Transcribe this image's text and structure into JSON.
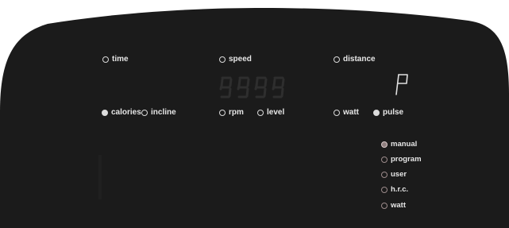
{
  "top_row": [
    {
      "id": "time",
      "label": "time",
      "filled": false
    },
    {
      "id": "speed",
      "label": "speed",
      "filled": false
    },
    {
      "id": "distance",
      "label": "distance",
      "filled": false
    }
  ],
  "middle_row": [
    {
      "id": "calories",
      "label": "calories",
      "filled": true
    },
    {
      "id": "incline",
      "label": "incline",
      "filled": false
    },
    {
      "id": "rpm",
      "label": "rpm",
      "filled": false
    },
    {
      "id": "level",
      "label": "level",
      "filled": false
    },
    {
      "id": "watt",
      "label": "watt",
      "filled": false
    },
    {
      "id": "pulse",
      "label": "pulse",
      "filled": true
    }
  ],
  "display": {
    "program_char": "P"
  },
  "modes": [
    {
      "id": "manual",
      "label": "manual",
      "active": true
    },
    {
      "id": "program",
      "label": "program",
      "active": false
    },
    {
      "id": "user",
      "label": "user",
      "active": false
    },
    {
      "id": "hrc",
      "label": "h.r.c.",
      "active": false
    },
    {
      "id": "watt",
      "label": "watt",
      "active": false
    }
  ],
  "colors": {
    "panel": "#1b1b1b",
    "text": "#e6e6e6",
    "mode_ring": "#9b8a8a"
  }
}
